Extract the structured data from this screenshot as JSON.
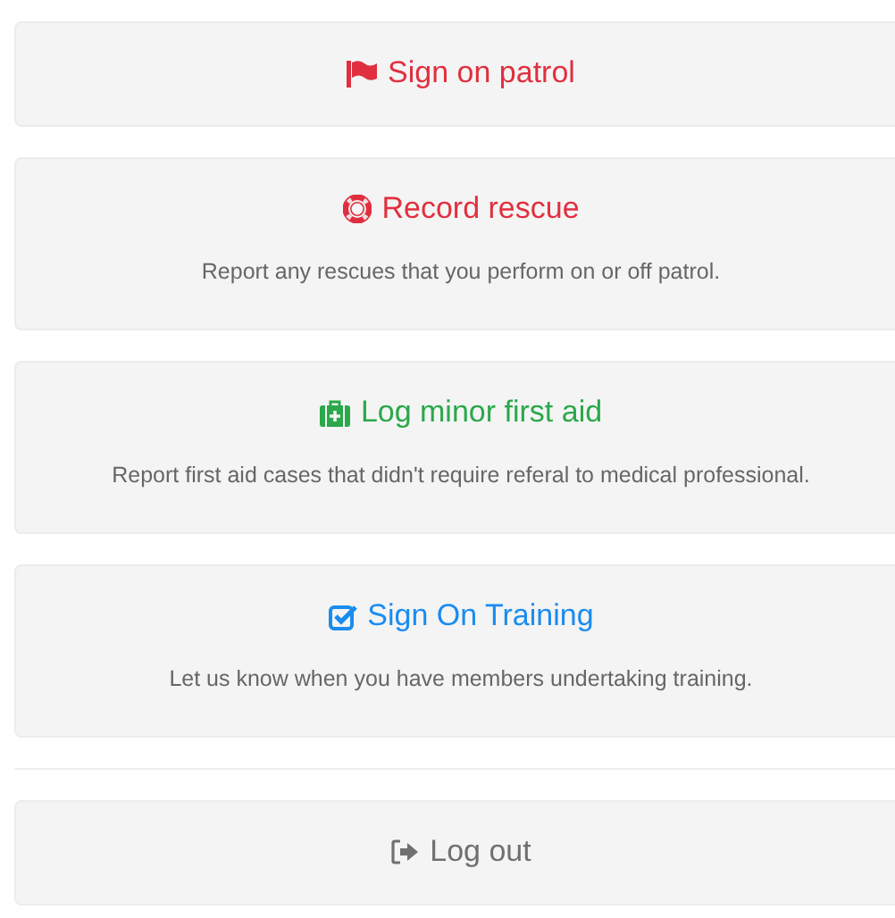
{
  "actions": [
    {
      "kind": "flag",
      "color": "#e0303f",
      "title": "Sign on patrol"
    },
    {
      "kind": "lifebuoy",
      "color": "#e0303f",
      "title": "Record rescue",
      "description": "Report any rescues that you perform on or off patrol."
    },
    {
      "kind": "first-aid",
      "color": "#2aa84a",
      "title": "Log minor first aid",
      "description": "Report first aid cases that didn't require referal to medical professional."
    },
    {
      "kind": "checkbox",
      "color": "#1a8cf0",
      "title": "Sign On Training",
      "description": "Let us know when you have members undertaking training."
    }
  ],
  "logout": {
    "kind": "sign-out",
    "color": "#707070",
    "title": "Log out"
  }
}
